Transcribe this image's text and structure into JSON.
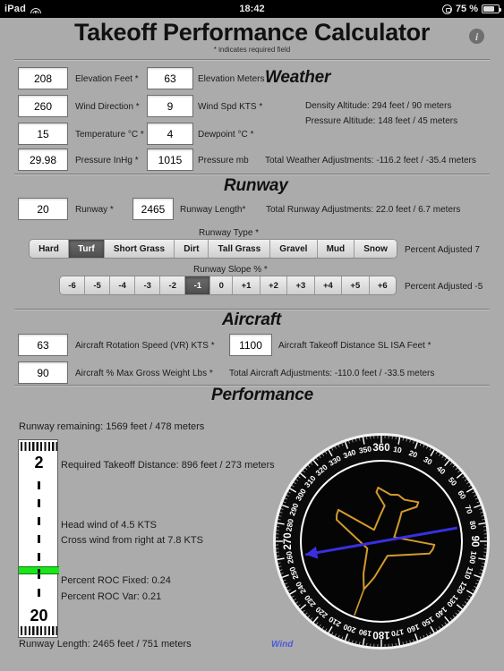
{
  "statusbar": {
    "device": "iPad",
    "wifi_icon": "wifi-icon",
    "time": "18:42",
    "rotation_lock_icon": "rotation-lock-icon",
    "battery_percent": "75 %",
    "battery_icon": "battery-icon"
  },
  "header": {
    "title": "Takeoff Performance Calculator",
    "required_note": "* indicates required field",
    "info_icon": "info-icon",
    "info_glyph": "i"
  },
  "weather": {
    "section_title": "Weather",
    "elevation_feet": {
      "value": "208",
      "label": "Elevation Feet *"
    },
    "elevation_meters": {
      "value": "63",
      "label": "Elevation Meters"
    },
    "wind_direction": {
      "value": "260",
      "label": "Wind Direction *"
    },
    "wind_speed": {
      "value": "9",
      "label": "Wind Spd KTS *"
    },
    "temperature": {
      "value": "15",
      "label": "Temperature °C *"
    },
    "dewpoint": {
      "value": "4",
      "label": "Dewpoint °C *"
    },
    "pressure_inhg": {
      "value": "29.98",
      "label": "Pressure InHg *"
    },
    "pressure_mb": {
      "value": "1015",
      "label": "Pressure mb"
    },
    "density_altitude": "Density Altitude: 294 feet / 90 meters",
    "pressure_altitude": "Pressure Altitude: 148 feet / 45 meters",
    "total_adjustments": "Total Weather Adjustments: -116.2 feet / -35.4 meters"
  },
  "runway": {
    "section_title": "Runway",
    "runway": {
      "value": "20",
      "label": "Runway *"
    },
    "runway_length": {
      "value": "2465",
      "label": "Runway Length*"
    },
    "total_adjustments": "Total Runway Adjustments: 22.0 feet / 6.7 meters",
    "type_label": "Runway Type *",
    "type_options": [
      "Hard",
      "Turf",
      "Short Grass",
      "Dirt",
      "Tall Grass",
      "Gravel",
      "Mud",
      "Snow"
    ],
    "type_selected": "Turf",
    "type_percent_adjusted": "Percent Adjusted 7",
    "slope_label": "Runway Slope % *",
    "slope_options": [
      "-6",
      "-5",
      "-4",
      "-3",
      "-2",
      "-1",
      "0",
      "+1",
      "+2",
      "+3",
      "+4",
      "+5",
      "+6"
    ],
    "slope_selected": "-1",
    "slope_percent_adjusted": "Percent Adjusted -5"
  },
  "aircraft": {
    "section_title": "Aircraft",
    "rotation_speed": {
      "value": "63",
      "label": "Aircraft Rotation Speed (VR) KTS *"
    },
    "takeoff_distance_sl_isa": {
      "value": "1100",
      "label": "Aircraft Takeoff Distance SL ISA Feet *"
    },
    "max_gross_weight_pct": {
      "value": "90",
      "label": "Aircraft % Max Gross Weight Lbs *"
    },
    "total_adjustments": "Total Aircraft Adjustments: -110.0 feet / -33.5 meters"
  },
  "performance": {
    "section_title": "Performance",
    "runway_remaining": "Runway remaining: 1569 feet / 478 meters",
    "required_takeoff_distance": "Required Takeoff Distance: 896 feet / 273 meters",
    "head_wind": "Head wind of 4.5 KTS",
    "cross_wind": "Cross wind from right at 7.8 KTS",
    "percent_roc_fixed": "Percent ROC Fixed: 0.24",
    "percent_roc_var": "Percent ROC Var: 0.21",
    "runway_length": "Runway Length: 2465 feet / 751 meters",
    "strip": {
      "top_number": "2",
      "bottom_number": "20",
      "takeoff_marker_color": "#19e619"
    },
    "compass": {
      "wind_label": "Wind",
      "wind_arrow_heading_deg": 260,
      "aircraft_heading_deg": 200,
      "tick_labels": [
        "360",
        "10",
        "20",
        "30",
        "40",
        "50",
        "60",
        "70",
        "80",
        "90",
        "100",
        "110",
        "120",
        "130",
        "140",
        "150",
        "180",
        "160",
        "170",
        "190",
        "200",
        "210",
        "220",
        "230",
        "240",
        "250",
        "260",
        "270",
        "280",
        "290",
        "300",
        "310",
        "320",
        "330",
        "340",
        "350"
      ],
      "cardinal_labels": [
        "360",
        "90",
        "180",
        "270"
      ],
      "aircraft_color": "#d49a2b",
      "wind_arrow_color": "#3a2fe0",
      "face_color": "#050505",
      "ring_color": "#f2f2f2"
    }
  }
}
